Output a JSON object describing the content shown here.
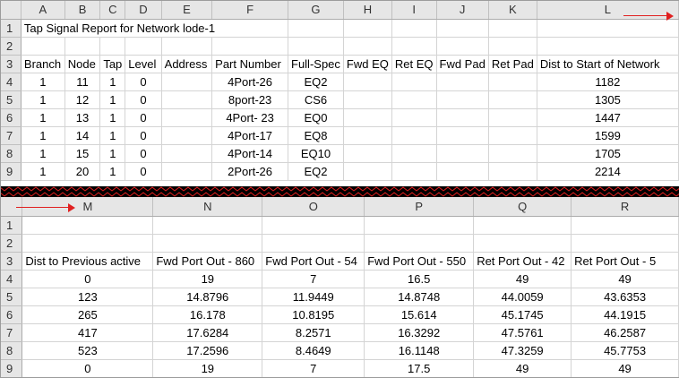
{
  "top_pane": {
    "columns": [
      "A",
      "B",
      "C",
      "D",
      "E",
      "F",
      "G",
      "H",
      "I",
      "J",
      "K",
      "L"
    ],
    "rows": [
      {
        "num": "1",
        "cells": [
          "Tap Signal Report for Network lode-1",
          "",
          "",
          "",
          "",
          "",
          "",
          "",
          "",
          "",
          "",
          ""
        ]
      },
      {
        "num": "2",
        "cells": [
          "",
          "",
          "",
          "",
          "",
          "",
          "",
          "",
          "",
          "",
          "",
          ""
        ]
      },
      {
        "num": "3",
        "cells": [
          "Branch",
          "Node",
          "Tap",
          "Level",
          "Address",
          "Part Number",
          "Full-Spec",
          "Fwd EQ",
          "Ret EQ",
          "Fwd Pad",
          "Ret Pad",
          "Dist to Start of Network"
        ]
      },
      {
        "num": "4",
        "cells": [
          "1",
          "11",
          "1",
          "0",
          "",
          "4Port-26",
          "EQ2",
          "",
          "",
          "",
          "",
          "1182"
        ]
      },
      {
        "num": "5",
        "cells": [
          "1",
          "12",
          "1",
          "0",
          "",
          "8port-23",
          "CS6",
          "",
          "",
          "",
          "",
          "1305"
        ]
      },
      {
        "num": "6",
        "cells": [
          "1",
          "13",
          "1",
          "0",
          "",
          "4Port- 23",
          "EQ0",
          "",
          "",
          "",
          "",
          "1447"
        ]
      },
      {
        "num": "7",
        "cells": [
          "1",
          "14",
          "1",
          "0",
          "",
          "4Port-17",
          "EQ8",
          "",
          "",
          "",
          "",
          "1599"
        ]
      },
      {
        "num": "8",
        "cells": [
          "1",
          "15",
          "1",
          "0",
          "",
          "4Port-14",
          "EQ10",
          "",
          "",
          "",
          "",
          "1705"
        ]
      },
      {
        "num": "9",
        "cells": [
          "1",
          "20",
          "1",
          "0",
          "",
          "2Port-26",
          "EQ2",
          "",
          "",
          "",
          "",
          "2214"
        ]
      }
    ]
  },
  "bottom_pane": {
    "columns": [
      "M",
      "N",
      "O",
      "P",
      "Q",
      "R"
    ],
    "rows": [
      {
        "num": "1",
        "cells": [
          "",
          "",
          "",
          "",
          "",
          ""
        ]
      },
      {
        "num": "2",
        "cells": [
          "",
          "",
          "",
          "",
          "",
          ""
        ]
      },
      {
        "num": "3",
        "cells": [
          "Dist to Previous active",
          "Fwd Port Out - 860",
          "Fwd Port Out - 54",
          "Fwd Port Out - 550",
          "Ret Port Out - 42",
          "Ret Port Out - 5"
        ]
      },
      {
        "num": "4",
        "cells": [
          "0",
          "19",
          "7",
          "16.5",
          "49",
          "49"
        ]
      },
      {
        "num": "5",
        "cells": [
          "123",
          "14.8796",
          "11.9449",
          "14.8748",
          "44.0059",
          "43.6353"
        ]
      },
      {
        "num": "6",
        "cells": [
          "265",
          "16.178",
          "10.8195",
          "15.614",
          "45.1745",
          "44.1915"
        ]
      },
      {
        "num": "7",
        "cells": [
          "417",
          "17.6284",
          "8.2571",
          "16.3292",
          "47.5761",
          "46.2587"
        ]
      },
      {
        "num": "8",
        "cells": [
          "523",
          "17.2596",
          "8.4649",
          "16.1148",
          "47.3259",
          "45.7753"
        ]
      },
      {
        "num": "9",
        "cells": [
          "0",
          "19",
          "7",
          "17.5",
          "49",
          "49"
        ]
      }
    ]
  },
  "colors": {
    "arrow": "#e02020",
    "zigzag": "#e02020",
    "band": "#000000",
    "header_bg": "#e6e6e6",
    "gridline": "#d4d4d4"
  }
}
